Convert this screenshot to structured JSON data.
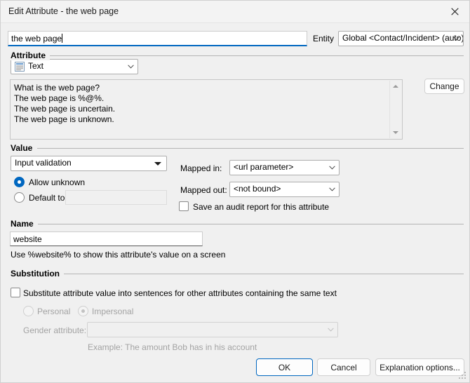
{
  "window": {
    "title": "Edit Attribute - the web page",
    "close_icon": "close-icon"
  },
  "top": {
    "attribute_text_value": "the web page",
    "entity_label": "Entity",
    "entity_value": "Global <Contact/Incident> (auto)"
  },
  "attribute_section": {
    "group_label": "Attribute",
    "type_value": "Text",
    "type_icon": "text-document-icon",
    "sentences": "What is the web page?\nThe web page is %@%.\nThe web page is uncertain.\nThe web page is unknown.",
    "change_button": "Change"
  },
  "value_section": {
    "group_label": "Value",
    "validation_value": "Input validation",
    "allow_unknown_label": "Allow unknown",
    "allow_unknown_checked": true,
    "default_to_label": "Default to:",
    "default_to_checked": false,
    "default_to_value": "",
    "mapped_in_label": "Mapped in:",
    "mapped_in_value": "<url parameter>",
    "mapped_out_label": "Mapped out:",
    "mapped_out_value": "<not bound>",
    "audit_label": "Save an audit report for this attribute",
    "audit_checked": false
  },
  "name_section": {
    "group_label": "Name",
    "name_value": "website",
    "hint": "Use %website% to show this attribute's value on a screen"
  },
  "substitution_section": {
    "group_label": "Substitution",
    "substitute_label": "Substitute attribute value into sentences for other attributes containing the same text",
    "substitute_checked": false,
    "personal_label": "Personal",
    "impersonal_label": "Impersonal",
    "impersonal_checked": true,
    "gender_attribute_label": "Gender attribute:",
    "gender_attribute_value": "",
    "example_text": "Example: The amount Bob has in his account"
  },
  "footer": {
    "ok_label": "OK",
    "cancel_label": "Cancel",
    "explanation_label": "Explanation options..."
  },
  "colors": {
    "accent": "#0067c0",
    "dialog_bg": "#f0f0f0",
    "titlebar_bg": "#f3f3f3",
    "text": "#000000",
    "disabled_text": "#a3a3a3"
  }
}
